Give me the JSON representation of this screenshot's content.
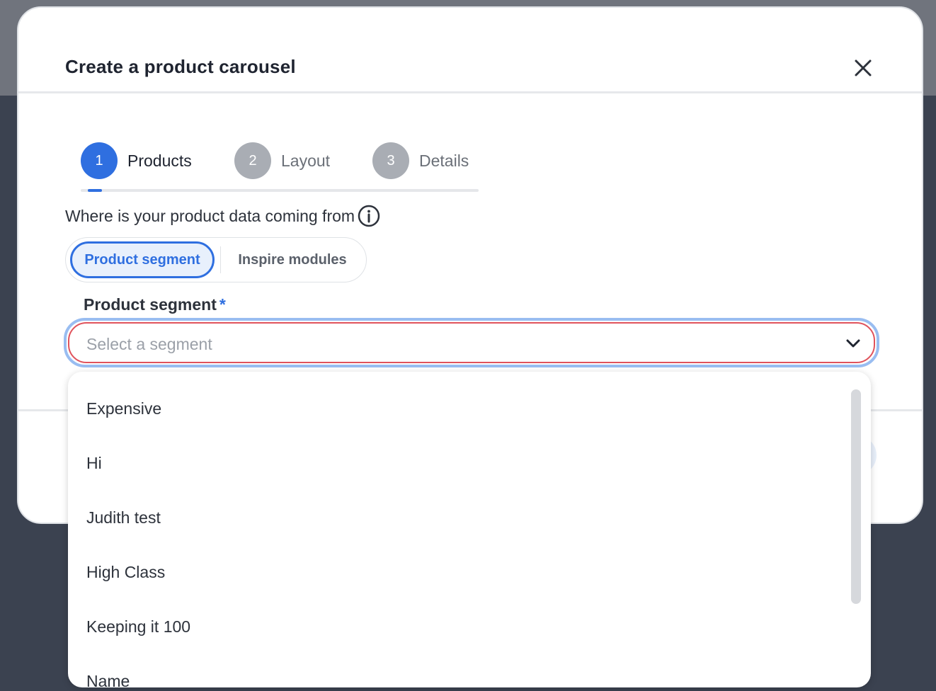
{
  "modal": {
    "title": "Create a product carousel"
  },
  "stepper": {
    "steps": [
      {
        "number": "1",
        "label": "Products",
        "state": "active"
      },
      {
        "number": "2",
        "label": "Layout",
        "state": "inactive"
      },
      {
        "number": "3",
        "label": "Details",
        "state": "inactive"
      }
    ]
  },
  "source": {
    "question": "Where is your product data coming from",
    "options": [
      {
        "label": "Product segment",
        "selected": true
      },
      {
        "label": "Inspire modules",
        "selected": false
      }
    ]
  },
  "segment_field": {
    "label": "Product segment",
    "required_mark": "*",
    "placeholder": "Select a segment",
    "value": ""
  },
  "dropdown": {
    "items": [
      "Expensive",
      "Hi",
      "Judith test",
      "High Class",
      "Keeping it 100",
      "Name"
    ]
  },
  "colors": {
    "accent": "#2f6fe0",
    "error": "#e0535c",
    "focus_ring": "#99bdf1"
  },
  "icons": {
    "close": "close-icon",
    "info": "info-icon",
    "chevron": "chevron-down-icon"
  }
}
